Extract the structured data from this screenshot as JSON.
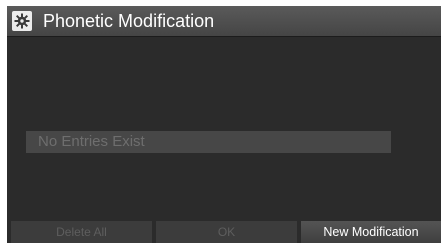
{
  "header": {
    "title": "Phonetic Modification",
    "icon": "settings-gear-icon"
  },
  "list": {
    "empty_message": "No Entries Exist"
  },
  "buttons": {
    "delete_all": "Delete All",
    "ok": "OK",
    "new_modification": "New Modification"
  },
  "colors": {
    "background": "#2b2b2b",
    "header": "#4e4e4e",
    "list_row": "#474747",
    "disabled_text": "#5e5e5e",
    "active_text": "#ffffff"
  }
}
